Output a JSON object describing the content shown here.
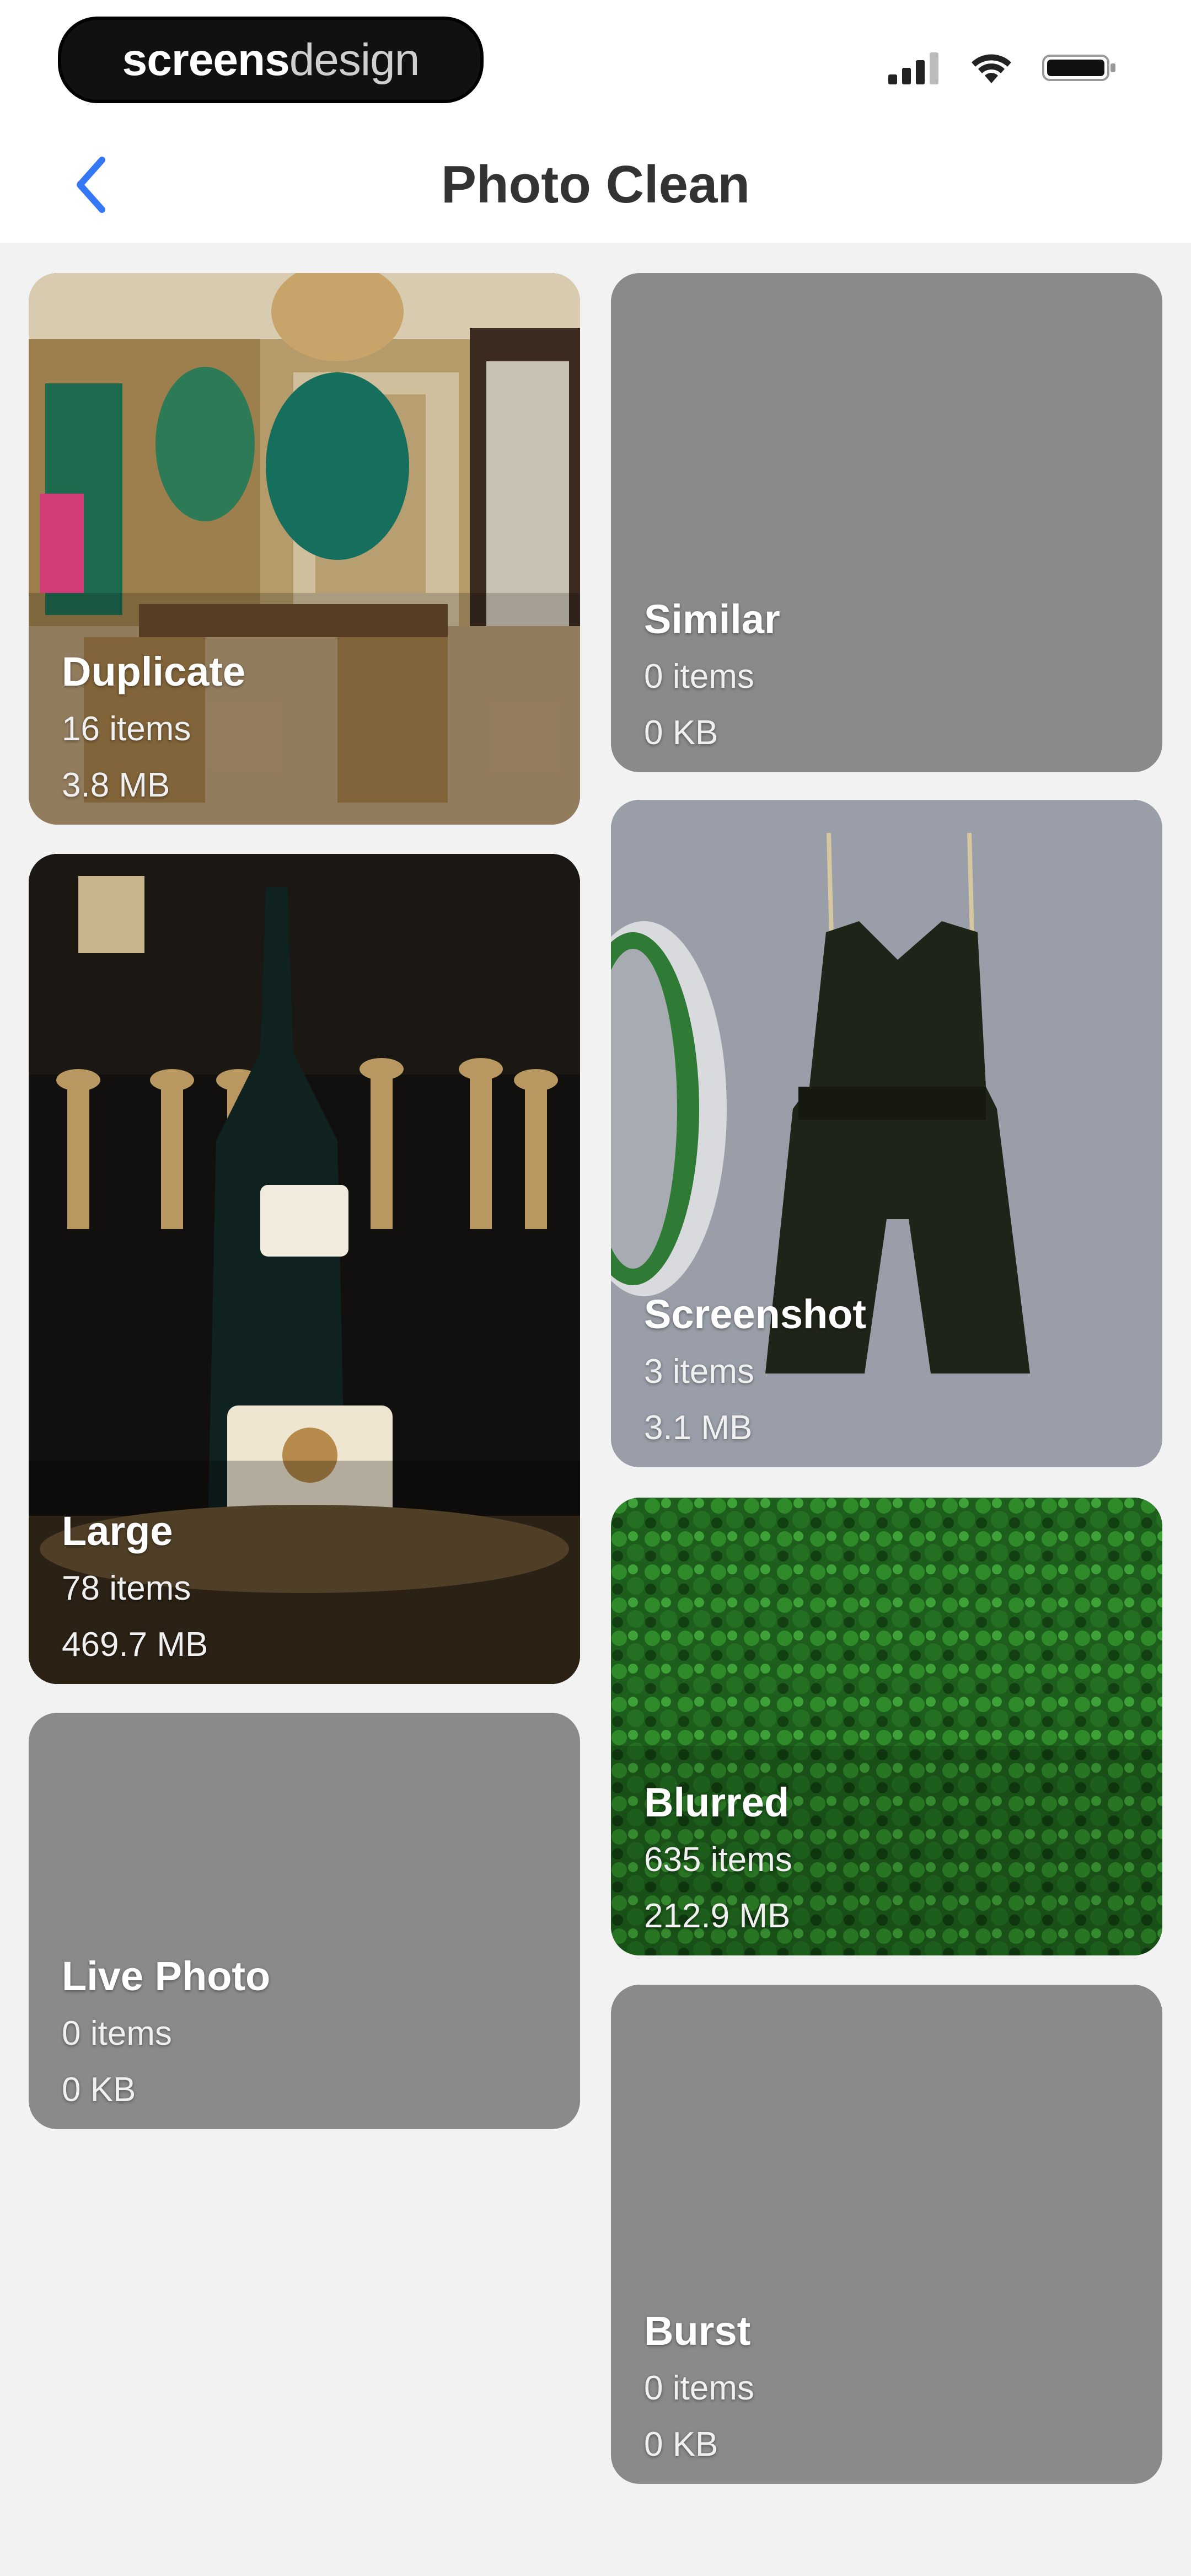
{
  "status_bar": {
    "brand_part1": "screens",
    "brand_part2": "design",
    "icons": [
      "signal-icon",
      "wifi-icon",
      "battery-icon"
    ]
  },
  "nav": {
    "back_icon": "chevron-left-icon",
    "title": "Photo Clean",
    "accent_color": "#3478f6"
  },
  "categories": [
    {
      "title": "Duplicate",
      "count": "16 items",
      "size": "3.8 MB",
      "thumbnail": "interior-room"
    },
    {
      "title": "Similar",
      "count": "0 items",
      "size": "0 KB",
      "thumbnail": "none"
    },
    {
      "title": "Large",
      "count": "78 items",
      "size": "469.7 MB",
      "thumbnail": "wine-bottle"
    },
    {
      "title": "Screenshot",
      "count": "3 items",
      "size": "3.1 MB",
      "thumbnail": "romper-on-hanger"
    },
    {
      "title": "Blurred",
      "count": "635 items",
      "size": "212.9 MB",
      "thumbnail": "green-foliage"
    },
    {
      "title": "Live Photo",
      "count": "0 items",
      "size": "0 KB",
      "thumbnail": "none"
    },
    {
      "title": "Burst",
      "count": "0 items",
      "size": "0 KB",
      "thumbnail": "none"
    }
  ]
}
